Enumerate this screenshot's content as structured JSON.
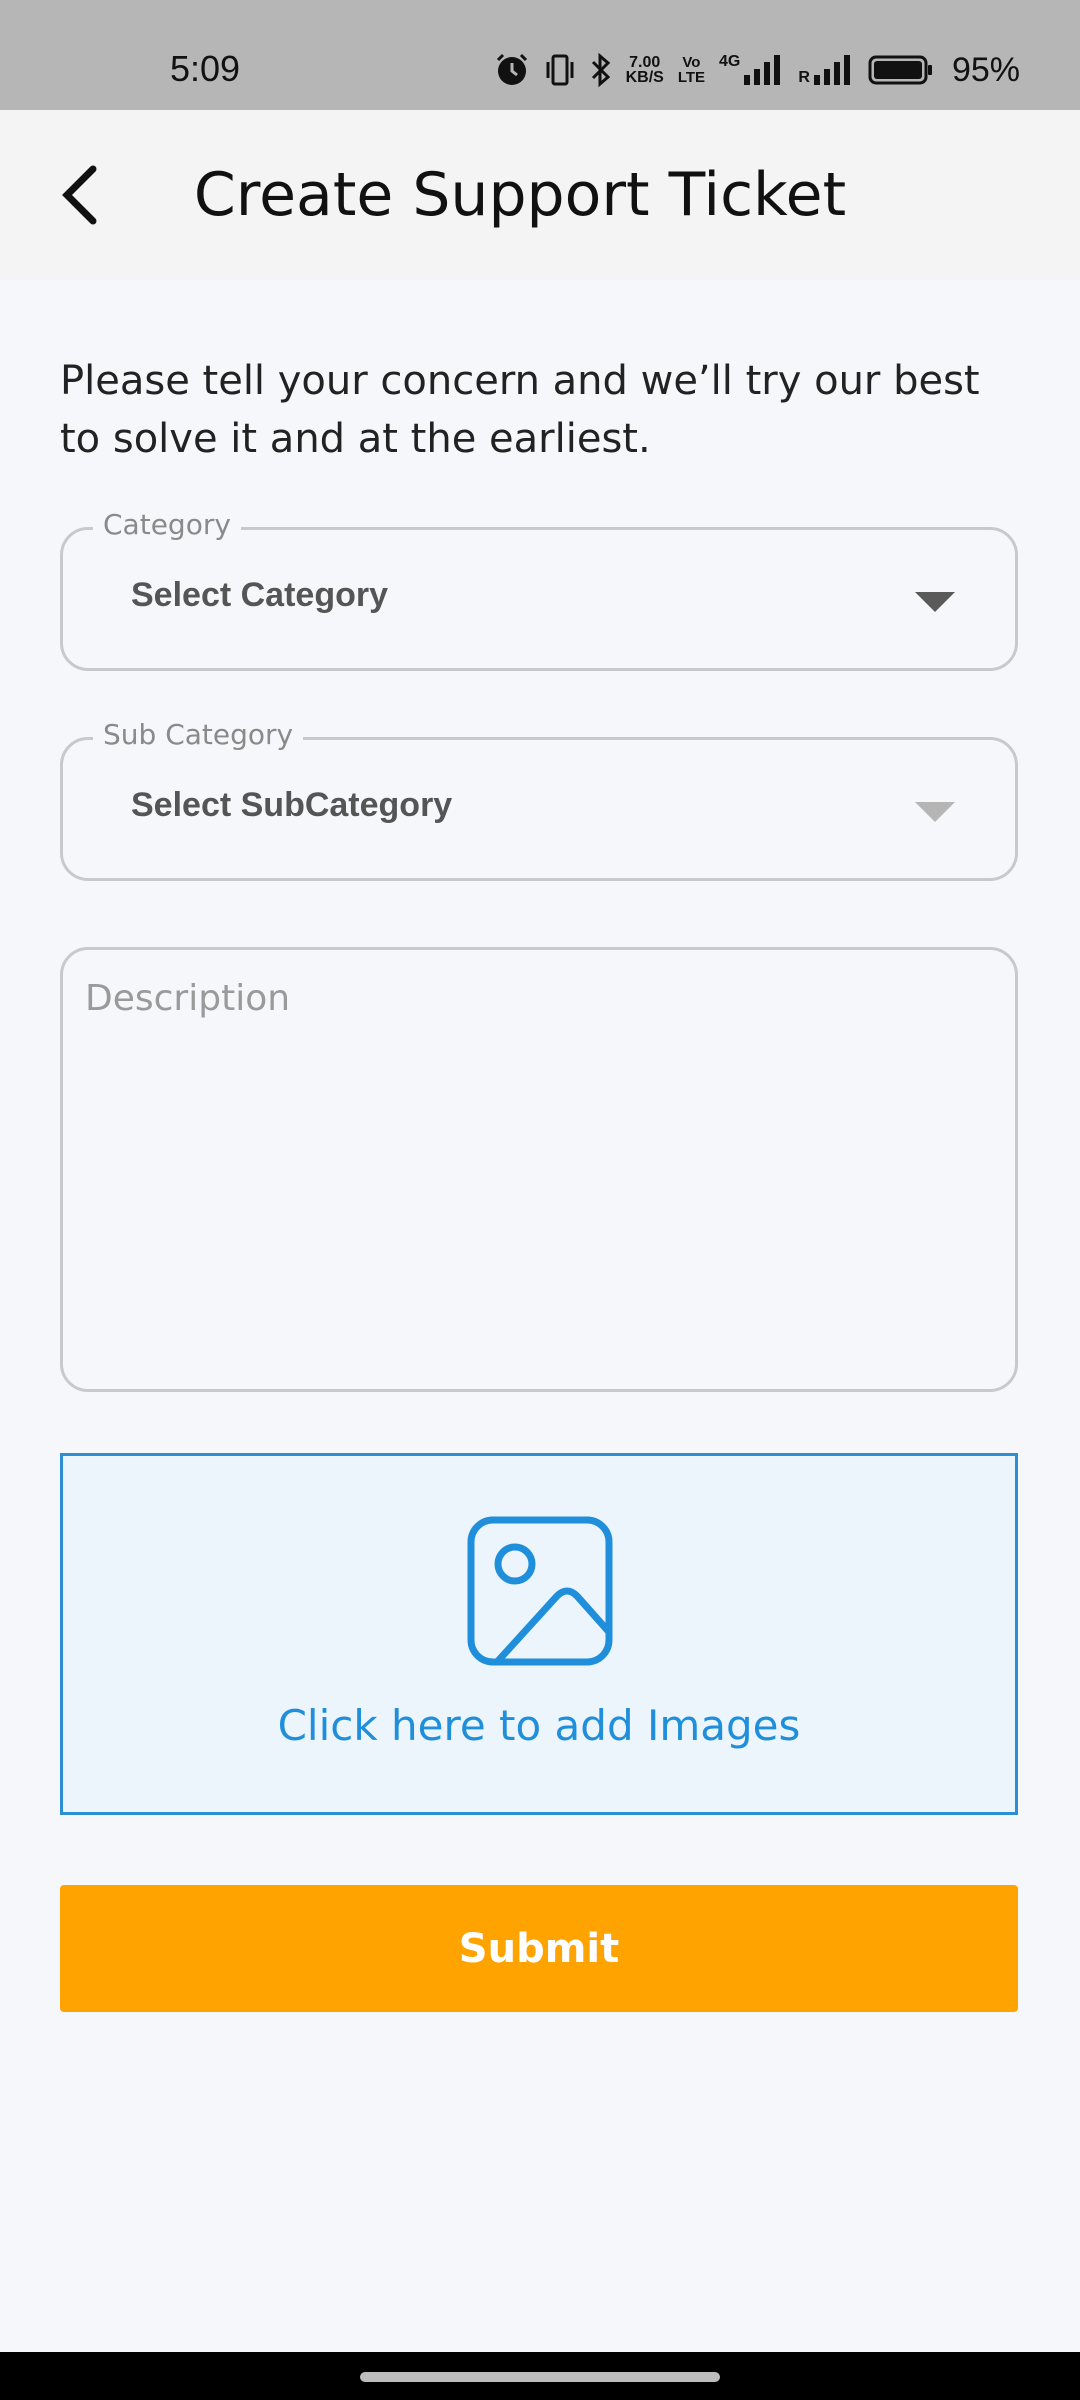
{
  "status_bar": {
    "time": "5:09",
    "speed_value": "7.00",
    "speed_unit": "KB/S",
    "volte_top": "Vo",
    "volte_bottom": "LTE",
    "network": "4G",
    "roaming": "R",
    "battery": "95%",
    "icons": [
      "alarm-icon",
      "vibrate-icon",
      "bluetooth-icon",
      "signal-icon",
      "battery-icon"
    ]
  },
  "app_bar": {
    "title": "Create Support Ticket",
    "back_icon": "chevron-left-icon"
  },
  "form": {
    "intro": "Please tell your concern and we’ll try our best to solve it and at the earliest.",
    "category": {
      "label": "Category",
      "value": "Select Category"
    },
    "sub_category": {
      "label": "Sub Category",
      "value": "Select SubCategory"
    },
    "description": {
      "placeholder": "Description"
    },
    "upload": {
      "label": "Click here to add Images",
      "icon": "image-icon"
    },
    "submit_label": "Submit"
  },
  "colors": {
    "accent": "#ffa300",
    "upload_blue": "#1f8fdb",
    "upload_bg": "#ecf5fb",
    "status_bar_bg": "#b6b6b6"
  }
}
